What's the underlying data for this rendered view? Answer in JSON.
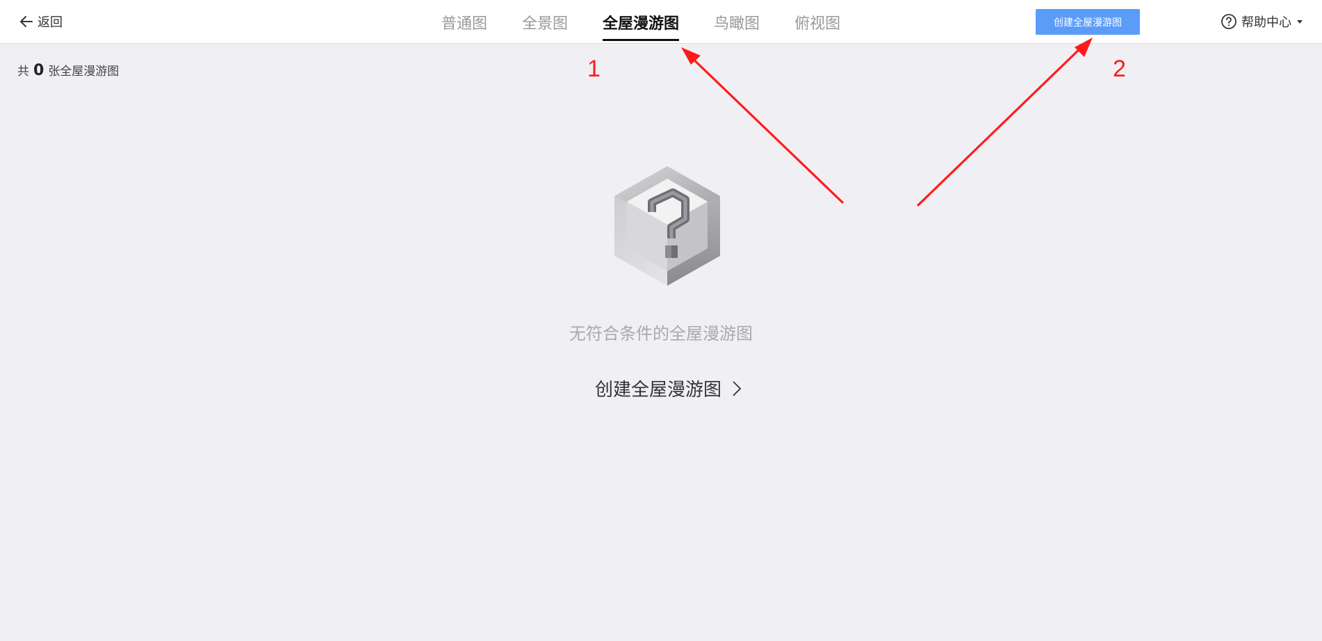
{
  "header": {
    "back_label": "返回",
    "tabs": [
      {
        "label": "普通图",
        "active": false
      },
      {
        "label": "全景图",
        "active": false
      },
      {
        "label": "全屋漫游图",
        "active": true
      },
      {
        "label": "鸟瞰图",
        "active": false
      },
      {
        "label": "俯视图",
        "active": false
      }
    ],
    "create_button_label": "创建全屋漫游图",
    "help_label": "帮助中心"
  },
  "summary": {
    "prefix": "共",
    "count": "0",
    "suffix": "张全屋漫游图"
  },
  "empty_state": {
    "message": "无符合条件的全屋漫游图",
    "action_label": "创建全屋漫游图"
  },
  "annotations": {
    "label_1": "1",
    "label_2": "2",
    "color": "#ff1a1a"
  },
  "colors": {
    "primary_button": "#5b9cf8",
    "background": "#f0eff4"
  }
}
